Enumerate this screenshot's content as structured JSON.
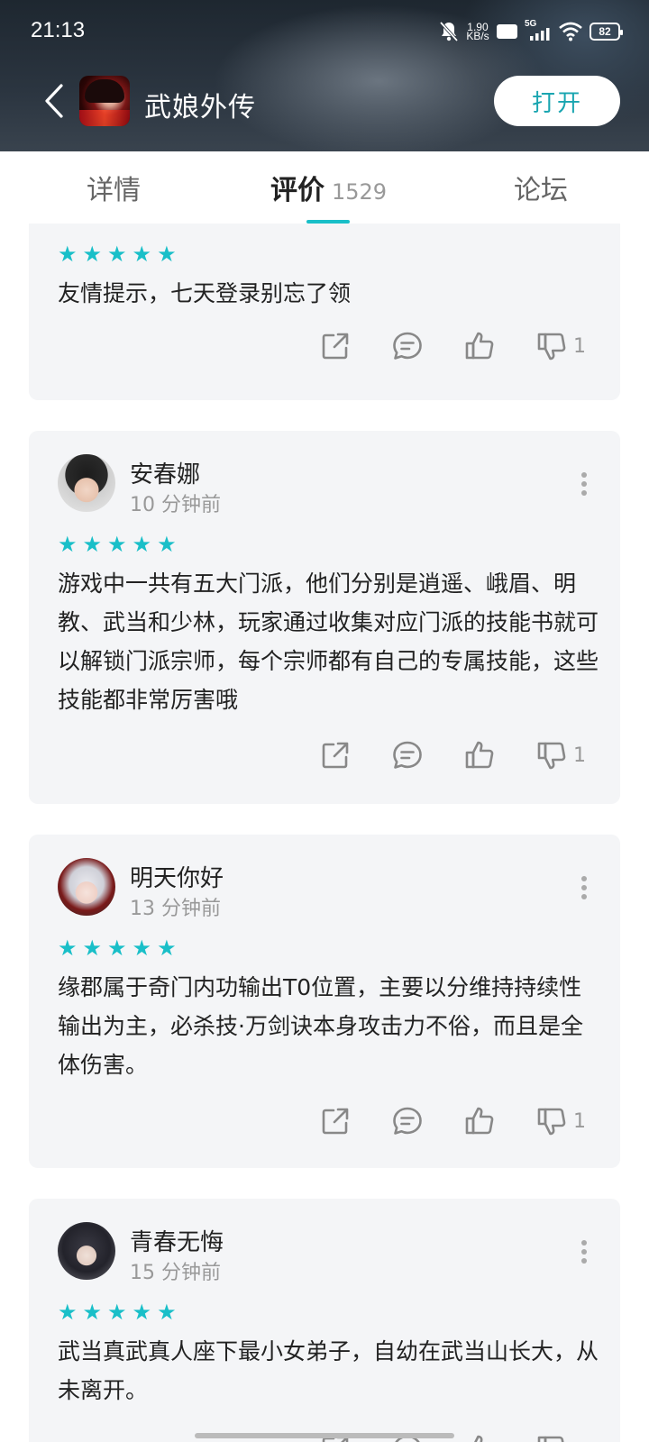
{
  "status_bar": {
    "time": "21:13",
    "net_speed_value": "1.90",
    "net_speed_unit": "KB/s",
    "hd_label": "HD",
    "signal_label": "5G",
    "battery": "82"
  },
  "header": {
    "app_title": "武娘外传",
    "open_label": "打开"
  },
  "tabs": {
    "details": "详情",
    "reviews": "评价",
    "reviews_count": "1529",
    "forum": "论坛",
    "active": "reviews"
  },
  "colors": {
    "accent": "#19bfc8",
    "open_text": "#19a5b0",
    "card_bg": "#f4f5f7"
  },
  "reviews": [
    {
      "username": "",
      "time": "",
      "rating": 5,
      "text": "友情提示，七天登录别忘了领",
      "dislike_count": "1"
    },
    {
      "username": "安春娜",
      "time": "10 分钟前",
      "rating": 5,
      "text": "游戏中一共有五大门派，他们分别是逍遥、峨眉、明教、武当和少林，玩家通过收集对应门派的技能书就可以解锁门派宗师，每个宗师都有自己的专属技能，这些技能都非常厉害哦",
      "dislike_count": "1"
    },
    {
      "username": "明天你好",
      "time": "13 分钟前",
      "rating": 5,
      "text": "缘郡属于奇门内功输出T0位置，主要以分维持持续性输出为主，必杀技·万剑诀本身攻击力不俗，而且是全体伤害。",
      "dislike_count": "1"
    },
    {
      "username": "青春无悔",
      "time": "15 分钟前",
      "rating": 5,
      "text": "武当真武真人座下最小女弟子，自幼在武当山长大，从未离开。",
      "dislike_count": ""
    }
  ]
}
